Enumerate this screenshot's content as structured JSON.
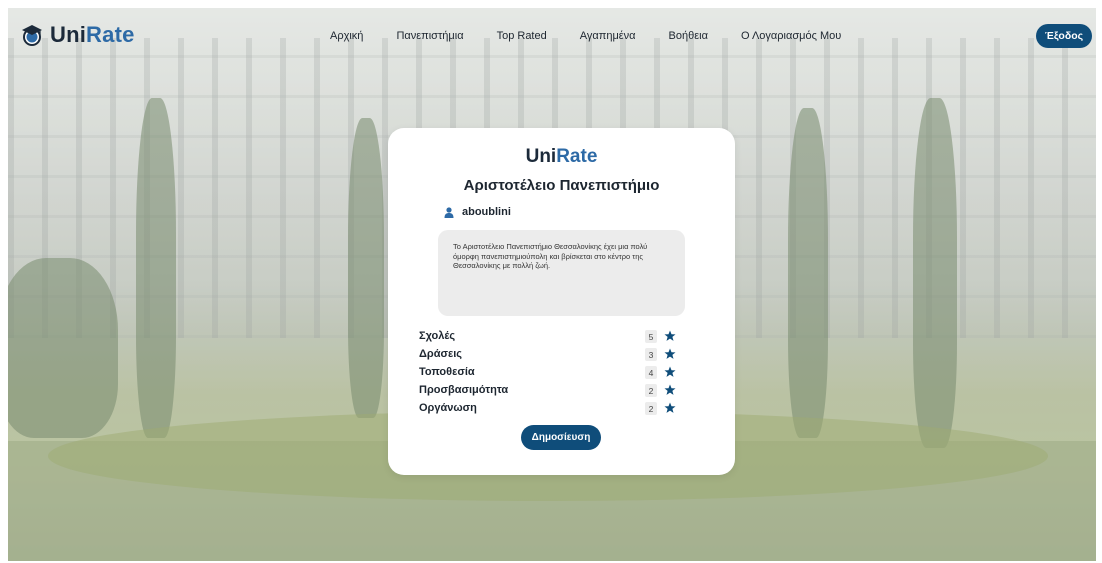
{
  "brand": {
    "uni": "Uni",
    "rate": "Rate"
  },
  "nav": {
    "links": [
      {
        "label": "Αρχική"
      },
      {
        "label": "Πανεπιστήμια"
      },
      {
        "label": "Top Rated"
      },
      {
        "label": "Αγαπημένα"
      },
      {
        "label": "Βοήθεια"
      },
      {
        "label": "Ο Λογαριασμός Μου"
      }
    ],
    "logout_label": "Έξοδος"
  },
  "card": {
    "brand_uni": "Uni",
    "brand_rate": "Rate",
    "title": "Αριστοτέλειο Πανεπιστήμιο",
    "username": "aboublini",
    "review_text": "Το Αριστοτέλειο Πανεπιστήμιο Θεσσαλονίκης έχει μια πολύ όμορφη πανεπιστημιούπολη και βρίσκεται στο κέντρο της Θεσσαλονίκης με πολλή ζωή.",
    "ratings": [
      {
        "label": "Σχολές",
        "value": "5"
      },
      {
        "label": "Δράσεις",
        "value": "3"
      },
      {
        "label": "Τοποθεσία",
        "value": "4"
      },
      {
        "label": "Προσβασιμότητα",
        "value": "2"
      },
      {
        "label": "Οργάνωση",
        "value": "2"
      }
    ],
    "publish_label": "Δημοσίευση"
  },
  "icons": {
    "logo": "graduation-cap-icon",
    "user": "user-icon",
    "star": "star-icon"
  },
  "colors": {
    "accent": "#0f4d7a",
    "brand_blue": "#2d6aa6",
    "brand_dark": "#1c2a3a"
  }
}
